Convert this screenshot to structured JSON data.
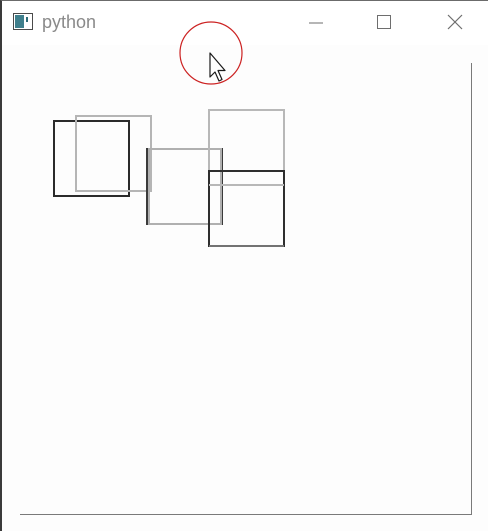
{
  "window": {
    "title": "python",
    "icon": "python-window-icon",
    "controls": {
      "minimize_icon": "minimize-icon",
      "maximize_icon": "maximize-icon",
      "close_icon": "close-icon"
    }
  },
  "canvas": {
    "shapes": [
      {
        "name": "square-1",
        "color": "#2b2b2b"
      },
      {
        "name": "square-2",
        "color": "#b5b5b5"
      },
      {
        "name": "square-3",
        "color": "#3a3a3a"
      },
      {
        "name": "square-4",
        "color": "#b0b0b0"
      },
      {
        "name": "rect-5",
        "color": "#b8b8b8"
      },
      {
        "name": "rect-6",
        "color": "#2e2e2e"
      }
    ]
  },
  "cursor": {
    "icon": "mouse-pointer-icon",
    "ring_color": "#cc2222"
  },
  "colors": {
    "background": "#fdfdfd",
    "frame_line": "#7a7a7a",
    "title_text": "#8a8a8a"
  }
}
